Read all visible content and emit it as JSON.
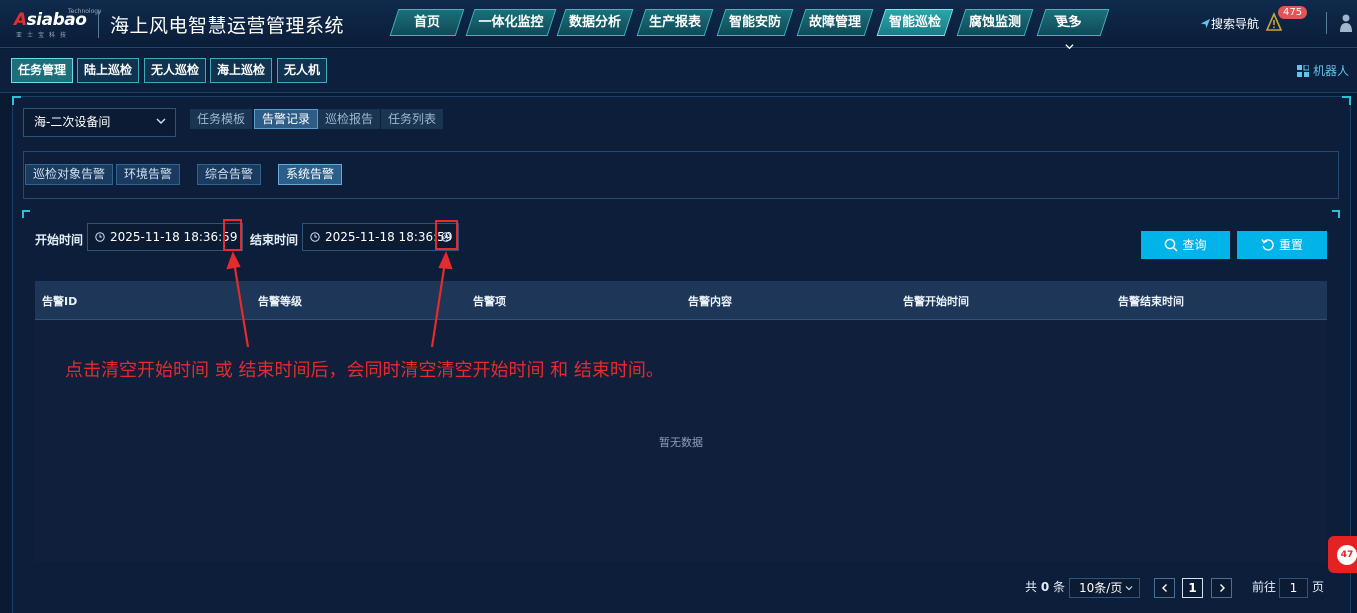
{
  "header": {
    "brand": "Asiabao",
    "brand_tech": "Technology",
    "brand_sub": "亚士宝科技",
    "title": "海上风电智慧运营管理系统",
    "nav": [
      "首页",
      "一体化监控",
      "数据分析",
      "生产报表",
      "智能安防",
      "故障管理",
      "智能巡检",
      "腐蚀监测",
      "更多"
    ],
    "active_nav": "智能巡检",
    "search_nav": "搜索导航",
    "notification_count": "475"
  },
  "subnav": {
    "items": [
      "任务管理",
      "陆上巡检",
      "无人巡检",
      "海上巡检",
      "无人机"
    ],
    "active": "任务管理",
    "robot": "机器人"
  },
  "main": {
    "location_select": "海-二次设备间",
    "tabs": [
      "任务模板",
      "告警记录",
      "巡检报告",
      "任务列表"
    ],
    "active_tab": "告警记录",
    "alarm_types": [
      "巡检对象告警",
      "环境告警",
      "综合告警",
      "系统告警"
    ],
    "active_alarm_type": "系统告警",
    "filters": {
      "start_label": "开始时间",
      "start_value": "2025-11-18 18:36:59",
      "end_label": "结束时间",
      "end_value": "2025-11-18 18:36:59"
    },
    "buttons": {
      "query": "查询",
      "reset": "重置"
    },
    "table": {
      "columns": [
        "告警ID",
        "告警等级",
        "告警项",
        "告警内容",
        "告警开始时间",
        "告警结束时间"
      ],
      "rows": [],
      "empty_text": "暂无数据"
    },
    "annotation": "点击清空开始时间 或 结束时间后，会同时清空清空开始时间 和 结束时间。",
    "pagination": {
      "total_prefix": "共",
      "total": "0",
      "total_suffix": "条",
      "page_size": "10条/页",
      "current_page": "1",
      "goto_prefix": "前往",
      "goto_value": "1",
      "goto_suffix": "页"
    }
  },
  "floating_badge": "47",
  "colors": {
    "accent": "#00b4ea",
    "annotation": "#e52b2b",
    "nav_active": "#2aa7a9"
  }
}
